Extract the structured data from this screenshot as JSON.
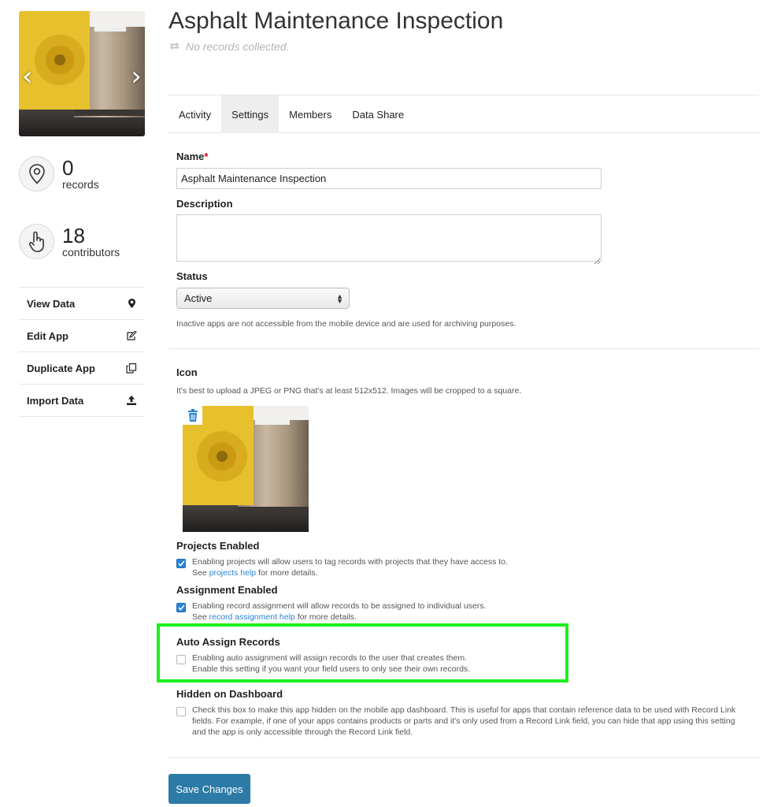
{
  "app": {
    "title": "Asphalt Maintenance Inspection",
    "status_line": "No records collected."
  },
  "sidebar": {
    "records": {
      "count": "0",
      "label": "records"
    },
    "contributors": {
      "count": "18",
      "label": "contributors"
    },
    "menu": [
      {
        "label": "View Data",
        "icon": "map-marker-icon"
      },
      {
        "label": "Edit App",
        "icon": "edit-icon"
      },
      {
        "label": "Duplicate App",
        "icon": "copy-icon"
      },
      {
        "label": "Import Data",
        "icon": "upload-icon"
      }
    ]
  },
  "tabs": [
    {
      "label": "Activity",
      "active": false
    },
    {
      "label": "Settings",
      "active": true
    },
    {
      "label": "Members",
      "active": false
    },
    {
      "label": "Data Share",
      "active": false
    }
  ],
  "form": {
    "name_label": "Name",
    "name_required_mark": "*",
    "name_value": "Asphalt Maintenance Inspection",
    "description_label": "Description",
    "description_value": "",
    "status_label": "Status",
    "status_value": "Active",
    "status_hint": "Inactive apps are not accessible from the mobile device and are used for archiving purposes.",
    "icon_label": "Icon",
    "icon_hint": "It's best to upload a JPEG or PNG that's at least 512x512. Images will be cropped to a square.",
    "projects": {
      "label": "Projects Enabled",
      "checked": true,
      "text": "Enabling projects will allow users to tag records with projects that they have access to.",
      "see": "See",
      "link": "projects help",
      "after": "for more details."
    },
    "assignment": {
      "label": "Assignment Enabled",
      "checked": true,
      "text": "Enabling record assignment will allow records to be assigned to individual users.",
      "see": "See",
      "link": "record assignment help",
      "after": "for more details."
    },
    "auto_assign": {
      "label": "Auto Assign Records",
      "checked": false,
      "line1": "Enabling auto assignment will assign records to the user that creates them.",
      "line2": "Enable this setting if you want your field users to only see their own records."
    },
    "hidden": {
      "label": "Hidden on Dashboard",
      "checked": false,
      "text": "Check this box to make this app hidden on the mobile app dashboard. This is useful for apps that contain reference data to be used with Record Link fields. For example, if one of your apps contains products or parts and it's only used from a Record Link field, you can hide that app using this setting and the app is only accessible through the Record Link field."
    },
    "save_label": "Save Changes"
  },
  "colors": {
    "accent": "#2a84d6",
    "button": "#2c7aa6",
    "highlight": "#1cf01c",
    "required": "#d0021b"
  }
}
